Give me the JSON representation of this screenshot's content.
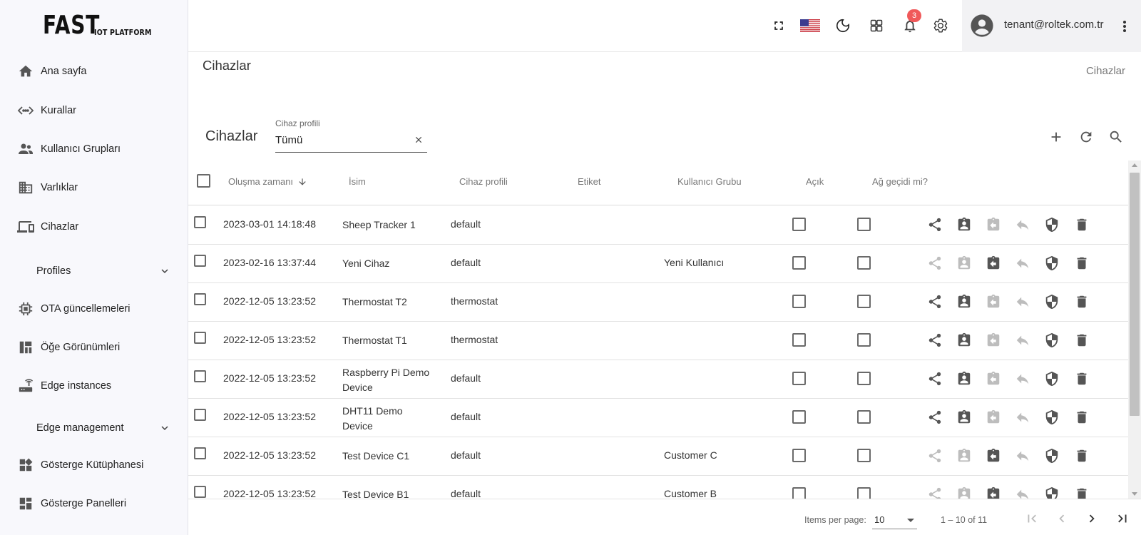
{
  "app": {
    "logo_main": "FAST",
    "logo_sub": "IOT PLATFORM"
  },
  "sidebar": {
    "items": [
      {
        "label": "Ana sayfa",
        "icon": "home-icon"
      },
      {
        "label": "Kurallar",
        "icon": "rule-chain-icon"
      },
      {
        "label": "Kullanıcı Grupları",
        "icon": "user-group-icon"
      },
      {
        "label": "Varlıklar",
        "icon": "building-icon"
      },
      {
        "label": "Cihazlar",
        "icon": "devices-icon"
      },
      {
        "label": "Profiles",
        "icon": "chevron-down-icon"
      },
      {
        "label": "OTA güncellemeleri",
        "icon": "chip-icon"
      },
      {
        "label": "Öğe Görünümleri",
        "icon": "widget-layout-icon"
      },
      {
        "label": "Edge instances",
        "icon": "router-icon"
      },
      {
        "label": "Edge management",
        "icon": "chevron-down-icon"
      },
      {
        "label": "Gösterge Kütüphanesi",
        "icon": "widgets-library-icon"
      },
      {
        "label": "Gösterge Panelleri",
        "icon": "dashboard-icon"
      }
    ]
  },
  "topbar": {
    "notification_count": "3",
    "user_email": "tenant@roltek.com.tr",
    "icons": [
      "fullscreen-icon",
      "us-flag-icon",
      "dark-mode-icon",
      "apps-grid-icon",
      "notification-bell-icon",
      "settings-gear-icon"
    ]
  },
  "page": {
    "title": "Cihazlar",
    "breadcrumb": "Cihazlar"
  },
  "card": {
    "title": "Cihazlar",
    "filter_label": "Cihaz profili",
    "filter_value": "Tümü"
  },
  "table": {
    "columns": [
      "Oluşma zamanı",
      "İsim",
      "Cihaz profili",
      "Etiket",
      "Kullanıcı Grubu",
      "Açık",
      "Ağ geçidi mi?"
    ],
    "rows": [
      {
        "created": "2023-03-01 14:18:48",
        "name": "Sheep Tracker 1",
        "profile": "default",
        "label": "",
        "customer": "",
        "assigned": false
      },
      {
        "created": "2023-02-16 13:37:44",
        "name": "Yeni Cihaz",
        "profile": "default",
        "label": "",
        "customer": "Yeni Kullanıcı",
        "assigned": true
      },
      {
        "created": "2022-12-05 13:23:52",
        "name": "Thermostat T2",
        "profile": "thermostat",
        "label": "",
        "customer": "",
        "assigned": false
      },
      {
        "created": "2022-12-05 13:23:52",
        "name": "Thermostat T1",
        "profile": "thermostat",
        "label": "",
        "customer": "",
        "assigned": false
      },
      {
        "created": "2022-12-05 13:23:52",
        "name": "Raspberry Pi Demo Device",
        "profile": "default",
        "label": "",
        "customer": "",
        "assigned": false
      },
      {
        "created": "2022-12-05 13:23:52",
        "name": "DHT11 Demo Device",
        "profile": "default",
        "label": "",
        "customer": "",
        "assigned": false
      },
      {
        "created": "2022-12-05 13:23:52",
        "name": "Test Device C1",
        "profile": "default",
        "label": "",
        "customer": "Customer C",
        "assigned": true
      },
      {
        "created": "2022-12-05 13:23:52",
        "name": "Test Device B1",
        "profile": "default",
        "label": "",
        "customer": "Customer B",
        "assigned": true
      }
    ]
  },
  "paginator": {
    "items_per_page_label": "Items per page:",
    "items_per_page": "10",
    "range": "1 – 10 of 11"
  },
  "colors": {
    "icon_dark": "#555555",
    "icon_disabled": "#bdbdbd",
    "badge": "#f0595a",
    "sidebar_bg": "#f8f8fc"
  }
}
